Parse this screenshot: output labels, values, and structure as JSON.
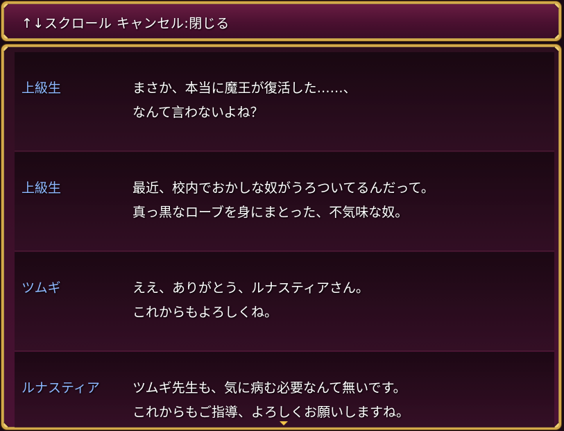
{
  "help": {
    "text": "↑↓スクロール キャンセル:閉じる"
  },
  "log": {
    "entries": [
      {
        "speaker": "上級生",
        "line1": "まさか、本当に魔王が復活した……、",
        "line2": "なんて言わないよね？"
      },
      {
        "speaker": "上級生",
        "line1": "最近、校内でおかしな奴がうろついてるんだって。",
        "line2": "真っ黒なローブを身にまとった、不気味な奴。"
      },
      {
        "speaker": "ツムギ",
        "line1": "ええ、ありがとう、ルナスティアさん。",
        "line2": "これからもよろしくね。"
      },
      {
        "speaker": "ルナスティア",
        "line1": "ツムギ先生も、気に病む必要なんて無いです。",
        "line2": "これからもご指導、よろしくお願いしますね。"
      }
    ]
  },
  "colors": {
    "frame_gold": "#d4a94a",
    "speaker_blue": "#8fb8ff",
    "window_crimson": "#4a1030"
  },
  "icons": {
    "scroll": "down-arrow-icon"
  }
}
